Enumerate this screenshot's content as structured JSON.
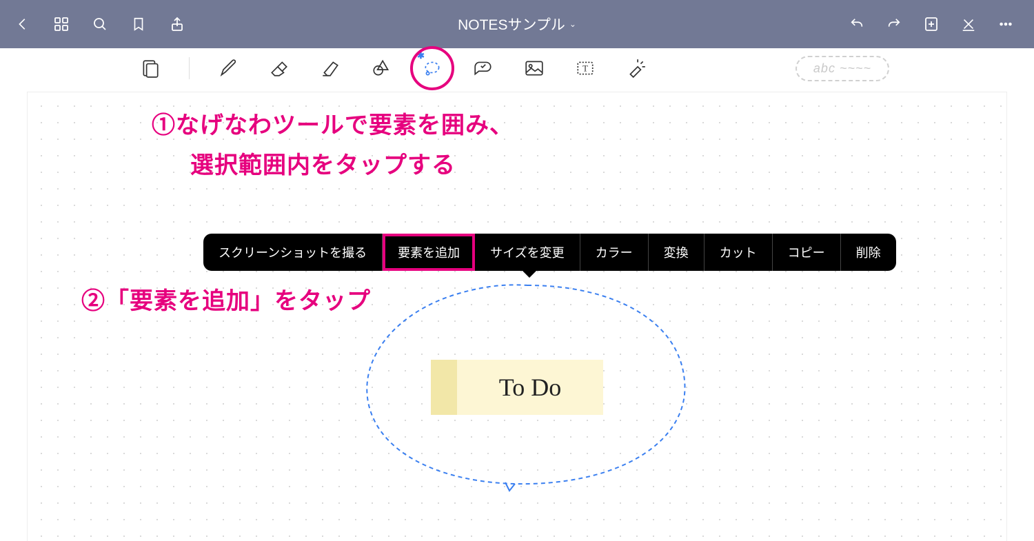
{
  "header": {
    "title": "NOTESサンプル"
  },
  "instructions": {
    "step1_line1": "①なげなわツールで要素を囲み、",
    "step1_line2": "選択範囲内をタップする",
    "step2": "②「要素を追加」をタップ"
  },
  "context_menu": {
    "items": [
      "スクリーンショットを撮る",
      "要素を追加",
      "サイズを変更",
      "カラー",
      "変換",
      "カット",
      "コピー",
      "削除"
    ],
    "highlighted_index": 1
  },
  "note": {
    "text": "To Do"
  },
  "favorites_placeholder": "abc ~~~~",
  "colors": {
    "accent_pink": "#e6007e",
    "topbar": "#727995",
    "lasso_blue": "#3a7ff0"
  }
}
